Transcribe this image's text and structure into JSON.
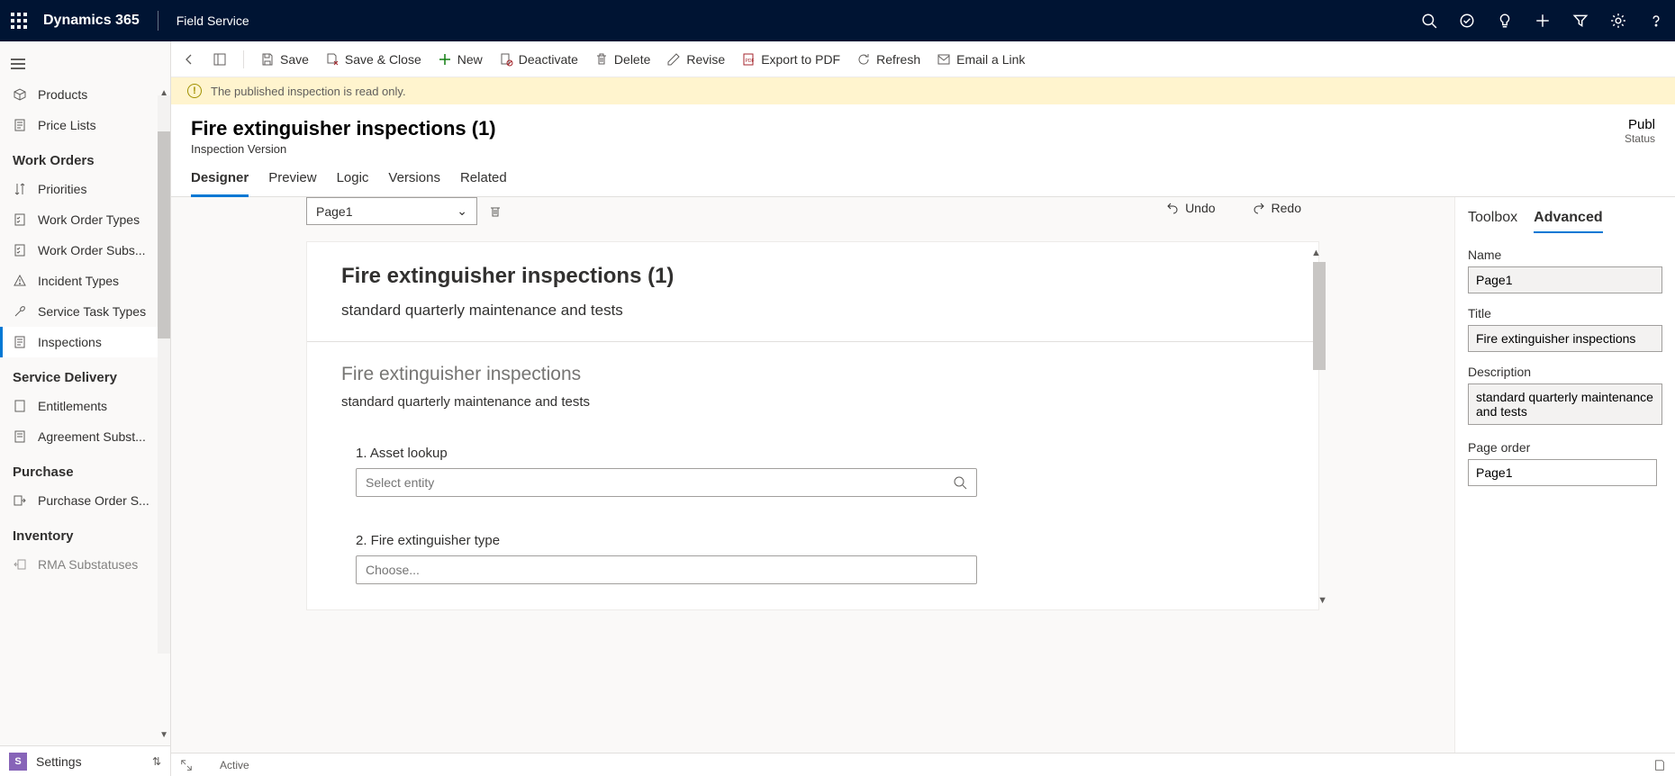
{
  "topbar": {
    "brand": "Dynamics 365",
    "module": "Field Service"
  },
  "sidebar": {
    "top_items": [
      {
        "label": "Products",
        "icon": "cube"
      },
      {
        "label": "Price Lists",
        "icon": "doc"
      }
    ],
    "groups": [
      {
        "title": "Work Orders",
        "items": [
          {
            "label": "Priorities",
            "icon": "arrows"
          },
          {
            "label": "Work Order Types",
            "icon": "clip"
          },
          {
            "label": "Work Order Subs...",
            "icon": "clip"
          },
          {
            "label": "Incident Types",
            "icon": "warn"
          },
          {
            "label": "Service Task Types",
            "icon": "wrench"
          },
          {
            "label": "Inspections",
            "icon": "clip",
            "active": true
          }
        ]
      },
      {
        "title": "Service Delivery",
        "items": [
          {
            "label": "Entitlements",
            "icon": "doc"
          },
          {
            "label": "Agreement Subst...",
            "icon": "doc"
          }
        ]
      },
      {
        "title": "Purchase",
        "items": [
          {
            "label": "Purchase Order S...",
            "icon": "out"
          }
        ]
      },
      {
        "title": "Inventory",
        "items": [
          {
            "label": "RMA Substatuses",
            "icon": "in"
          }
        ]
      }
    ],
    "footer": {
      "badge": "S",
      "label": "Settings"
    }
  },
  "cmdbar": {
    "save": "Save",
    "save_close": "Save & Close",
    "new": "New",
    "deactivate": "Deactivate",
    "delete": "Delete",
    "revise": "Revise",
    "export": "Export to PDF",
    "refresh": "Refresh",
    "email": "Email a Link"
  },
  "notice": "The published inspection is read only.",
  "record": {
    "title": "Fire extinguisher inspections (1)",
    "subtitle": "Inspection Version",
    "status_value": "Publ",
    "status_label": "Status"
  },
  "tabs": [
    "Designer",
    "Preview",
    "Logic",
    "Versions",
    "Related"
  ],
  "designer": {
    "page": "Page1",
    "undo": "Undo",
    "redo": "Redo",
    "card_title": "Fire extinguisher inspections (1)",
    "card_desc": "standard quarterly maintenance and tests",
    "section_title": "Fire extinguisher inspections",
    "section_desc": "standard quarterly maintenance and tests",
    "q1_label": "1. Asset lookup",
    "q1_placeholder": "Select entity",
    "q2_label": "2. Fire extinguisher type",
    "q2_placeholder": "Choose..."
  },
  "sidepanel": {
    "tabs": [
      "Toolbox",
      "Advanced"
    ],
    "name_label": "Name",
    "name_value": "Page1",
    "title_label": "Title",
    "title_value": "Fire extinguisher inspections",
    "desc_label": "Description",
    "desc_value": "standard quarterly maintenance and tests",
    "order_label": "Page order",
    "order_value": "Page1"
  },
  "statusbar": {
    "state": "Active"
  }
}
